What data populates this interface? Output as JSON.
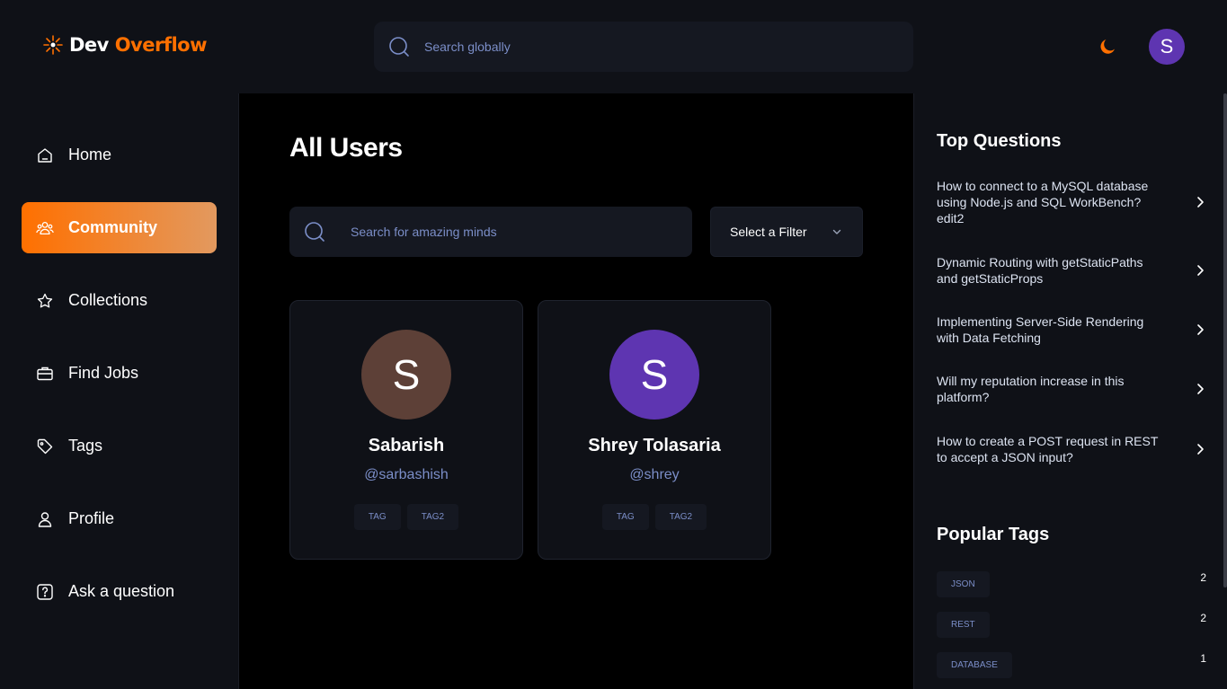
{
  "app": {
    "logo_dev": "Dev",
    "logo_overflow": "Overflow",
    "global_search_placeholder": "Search globally",
    "user_initial": "S"
  },
  "sidebar": {
    "items": [
      {
        "label": "Home",
        "icon": "home-icon"
      },
      {
        "label": "Community",
        "icon": "users-icon",
        "active": true
      },
      {
        "label": "Collections",
        "icon": "star-icon"
      },
      {
        "label": "Find Jobs",
        "icon": "suitcase-icon"
      },
      {
        "label": "Tags",
        "icon": "tag-icon"
      },
      {
        "label": "Profile",
        "icon": "user-icon"
      },
      {
        "label": "Ask a question",
        "icon": "question-icon"
      }
    ]
  },
  "main": {
    "title": "All Users",
    "search_placeholder": "Search for amazing minds",
    "filter_label": "Select a Filter",
    "users": [
      {
        "initial": "S",
        "name": "Sabarish",
        "handle": "@sarbashish",
        "avatar_color": "#5d4037",
        "tags": [
          "TAG",
          "TAG2"
        ]
      },
      {
        "initial": "S",
        "name": "Shrey Tolasaria",
        "handle": "@shrey",
        "avatar_color": "#5e35b1",
        "tags": [
          "TAG",
          "TAG2"
        ]
      }
    ]
  },
  "rightbar": {
    "top_questions_title": "Top Questions",
    "questions": [
      "How to connect to a MySQL database using Node.js and SQL WorkBench? edit2",
      "Dynamic Routing with getStaticPaths and getStaticProps",
      "Implementing Server-Side Rendering with Data Fetching",
      "Will my reputation increase in this platform?",
      "How to create a POST request in REST to accept a JSON input?"
    ],
    "popular_tags_title": "Popular Tags",
    "popular_tags": [
      {
        "name": "JSON",
        "count": "2"
      },
      {
        "name": "REST",
        "count": "2"
      },
      {
        "name": "DATABASE",
        "count": "1"
      }
    ]
  },
  "colors": {
    "accent": "#ff7000",
    "accent_light": "#e2995f",
    "link_blue": "#7b8ec8",
    "background": "#0f1117"
  }
}
